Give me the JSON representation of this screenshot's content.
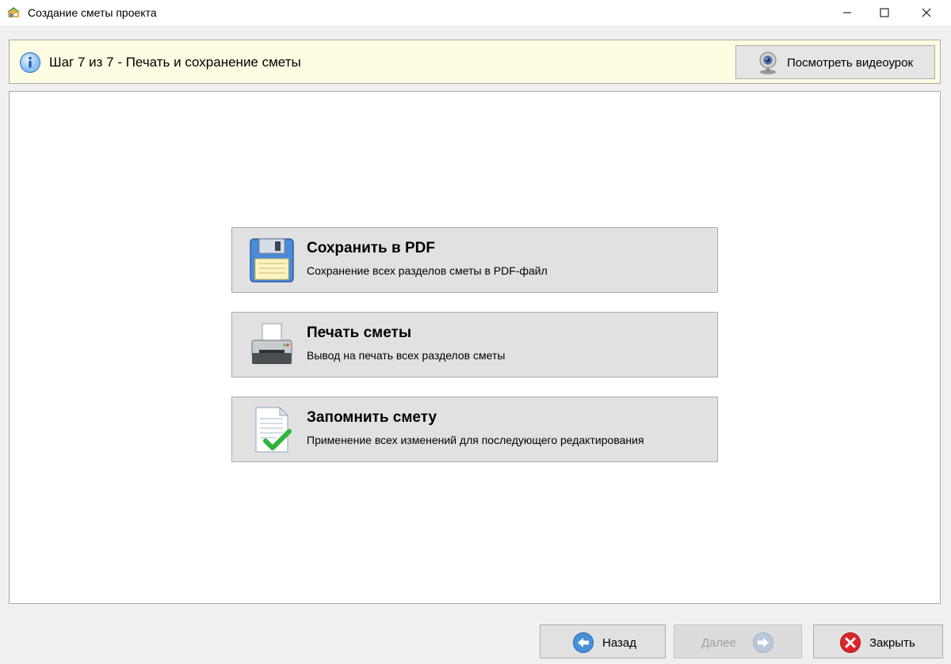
{
  "window": {
    "title": "Создание сметы проекта",
    "app_icon": "house-icon",
    "controls": [
      "minimize-icon",
      "maximize-icon",
      "close-icon"
    ]
  },
  "header": {
    "icon": "info-icon",
    "step_text": "Шаг 7 из 7 - Печать и сохранение сметы",
    "video_button": {
      "icon": "webcam-icon",
      "label": "Посмотреть видеоурок"
    }
  },
  "actions": [
    {
      "id": "save-pdf",
      "icon": "floppy-disk-icon",
      "title": "Сохранить в PDF",
      "description": "Сохранение всех разделов сметы в PDF-файл"
    },
    {
      "id": "print",
      "icon": "printer-icon",
      "title": "Печать сметы",
      "description": "Вывод на печать всех разделов сметы"
    },
    {
      "id": "remember",
      "icon": "document-check-icon",
      "title": "Запомнить смету",
      "description": "Применение всех изменений для последующего редактирования"
    }
  ],
  "footer": {
    "back": {
      "label": "Назад",
      "icon": "arrow-left-icon",
      "enabled": true
    },
    "next": {
      "label": "Далее",
      "icon": "arrow-right-icon",
      "enabled": false
    },
    "close": {
      "label": "Закрыть",
      "icon": "close-circle-icon",
      "enabled": true
    }
  },
  "colors": {
    "header_bg": "#fffde1",
    "arrow_blue": "#4a90d9",
    "close_red": "#d9262b",
    "check_green": "#2fb43a"
  }
}
